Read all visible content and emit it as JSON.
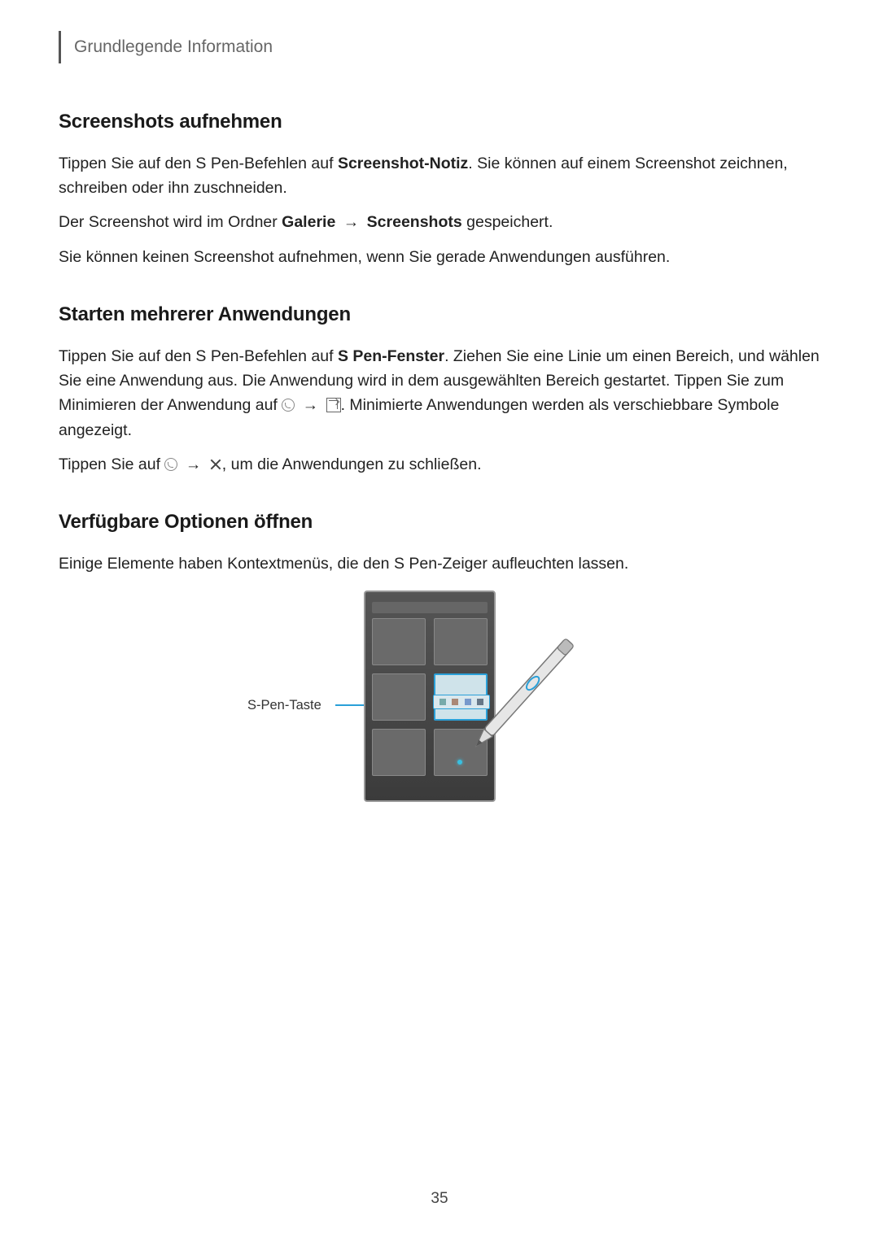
{
  "header": {
    "title": "Grundlegende Information"
  },
  "sections": {
    "s1": {
      "heading": "Screenshots aufnehmen",
      "p1a": "Tippen Sie auf den S Pen-Befehlen auf ",
      "p1b_bold": "Screenshot-Notiz",
      "p1c": ". Sie können auf einem Screenshot zeichnen, schreiben oder ihn zuschneiden.",
      "p2a": "Der Screenshot wird im Ordner ",
      "p2b_bold": "Galerie",
      "p2arrow": " → ",
      "p2c_bold": "Screenshots",
      "p2d": " gespeichert.",
      "p3": "Sie können keinen Screenshot aufnehmen, wenn Sie gerade Anwendungen ausführen."
    },
    "s2": {
      "heading": "Starten mehrerer Anwendungen",
      "p1a": "Tippen Sie auf den S Pen-Befehlen auf ",
      "p1b_bold": "S Pen-Fenster",
      "p1c": ". Ziehen Sie eine Linie um einen Bereich, und wählen Sie eine Anwendung aus. Die Anwendung wird in dem ausgewählten Bereich gestartet. Tippen Sie zum Minimieren der Anwendung auf ",
      "p1arrow": " → ",
      "p1d": ". Minimierte Anwendungen werden als verschiebbare Symbole angezeigt.",
      "p2a": "Tippen Sie auf ",
      "p2arrow": " → ",
      "p2b": ", um die Anwendungen zu schließen."
    },
    "s3": {
      "heading": "Verfügbare Optionen öffnen",
      "p1": "Einige Elemente haben Kontextmenüs, die den S Pen-Zeiger aufleuchten lassen."
    }
  },
  "illustration": {
    "label": "S-Pen-Taste"
  },
  "page_number": "35"
}
